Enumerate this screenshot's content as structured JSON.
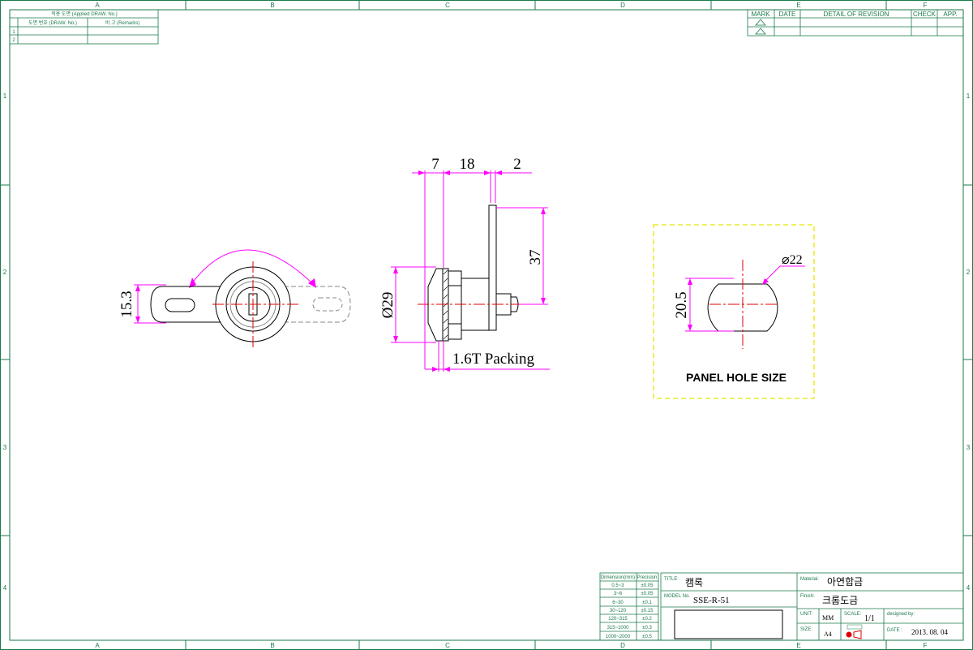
{
  "zones": {
    "columns": [
      "A",
      "B",
      "C",
      "D",
      "E",
      "F"
    ],
    "rows": [
      "1",
      "2",
      "3",
      "4"
    ]
  },
  "applied_table": {
    "title": "적용 도면 (Applied DRAW. No.)",
    "col1": "도면 번호 (DRAW. No.)",
    "col2": "비 고 (Remarks)",
    "rows": [
      "1",
      "2"
    ]
  },
  "revision_table": {
    "mark": "MARK",
    "date": "DATE",
    "detail": "DETAIL OF REVISION",
    "check": "CHECK",
    "app": "APP."
  },
  "dimensions": {
    "d7": "7",
    "d18": "18",
    "d2": "2",
    "d37": "37",
    "d29": "Ø29",
    "packing": "1.6T Packing",
    "d153": "15.3",
    "d205": "20.5",
    "d22": "⌀22"
  },
  "panel_hole_label": "PANEL HOLE SIZE",
  "tolerance_table": {
    "header_dim": "Dimension(mm)",
    "header_prec": "Precision",
    "rows": [
      [
        "0.5~3",
        "±0.05"
      ],
      [
        "3~6",
        "±0.05"
      ],
      [
        "6~30",
        "±0.1"
      ],
      [
        "30~120",
        "±0.15"
      ],
      [
        "120~315",
        "±0.2"
      ],
      [
        "315~1000",
        "±0.3"
      ],
      [
        "1000~2000",
        "±0.5"
      ]
    ]
  },
  "title_block": {
    "title_label": "TITLE:",
    "title_value": "캠록",
    "model_label": "MODEL No.",
    "model_value": "SSE-R-51",
    "material_label": "Material:",
    "material_value": "아연합금",
    "finish_label": "Finish:",
    "finish_value": "크롬도금",
    "unit_label": "UNIT:",
    "unit_value": "MM",
    "scale_label": "SCALE:",
    "scale_value": "1/1",
    "designed_label": "designed by:",
    "size_label": "SIZE:",
    "size_value": "A4",
    "date_label": "DATE :",
    "date_value": "2013. 08. 04"
  },
  "colors": {
    "frame": "#1a7a4a",
    "centerline": "#e00000",
    "dimension": "#ff00ff",
    "panel_box": "#e6e600"
  }
}
